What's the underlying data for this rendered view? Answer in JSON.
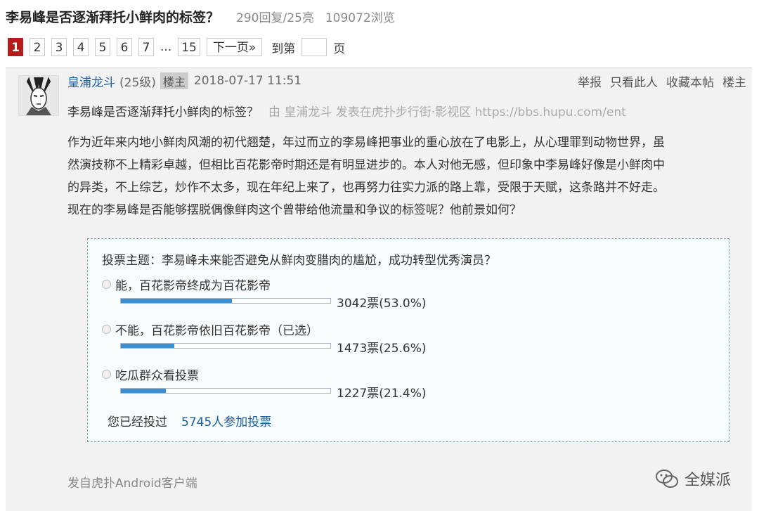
{
  "thread": {
    "title": "李易峰是否逐渐拜托小鲜肉的标签？",
    "replies": "290回复",
    "lights": "/25亮",
    "views": "109072浏览"
  },
  "pagination": {
    "pages": [
      "1",
      "2",
      "3",
      "4",
      "5",
      "6",
      "7"
    ],
    "ellipsis": "...",
    "last": "15",
    "next_label": "下一页»",
    "goto_label": "到第",
    "goto_suffix": "页",
    "current": "1"
  },
  "post": {
    "author": "皇浦龙斗",
    "level": "(25级)",
    "op_badge": "楼主",
    "time": "2018-07-17 11:51",
    "actions": [
      "举报",
      "只看此人",
      "收藏本帖",
      "楼主"
    ],
    "ref_title": "李易峰是否逐渐拜托小鲜肉的标签？",
    "ref_meta": "由 皇浦龙斗 发表在虎扑步行街·影视区 https://bbs.hupu.com/ent",
    "body_lines": [
      "作为近年来内地小鲜肉风潮的初代翘楚，年过而立的李易峰把事业的重心放在了电影上，从心理罪到动物世界，虽",
      "然演技称不上精彩卓越，但相比百花影帝时期还是有明显进步的。本人对他无感，但印象中李易峰好像是小鲜肉中",
      "的异类，不上综艺，炒作不太多，现在年纪上来了，也再努力往实力派的路上靠，受限于天赋，这条路并不好走。",
      "现在的李易峰是否能够摆脱偶像鲜肉这个曾带给他流量和争议的标签呢？他前景如何？"
    ],
    "source": "发自虎扑Android客户端"
  },
  "poll": {
    "topic": "投票主题：李易峰未来能否避免从鲜肉变腊肉的尴尬，成功转型优秀演员？",
    "options": [
      {
        "label": "能，百花影帝终成为百花影帝",
        "result": "3042票(53.0%)",
        "fraction": 0.53
      },
      {
        "label": "不能，百花影帝依旧百花影帝（已选）",
        "result": "1473票(25.6%)",
        "fraction": 0.256
      },
      {
        "label": "吃瓜群众看投票",
        "result": "1227票(21.4%)",
        "fraction": 0.214
      }
    ],
    "voted_text": "您已经投过",
    "participants": "5745人参加投票"
  },
  "watermark": {
    "text": "全媒派"
  },
  "colors": {
    "active_page": "#b71c1c",
    "link": "#1a5ea3",
    "bar": "#3b8fd0",
    "poll_border": "#6aab9c"
  }
}
